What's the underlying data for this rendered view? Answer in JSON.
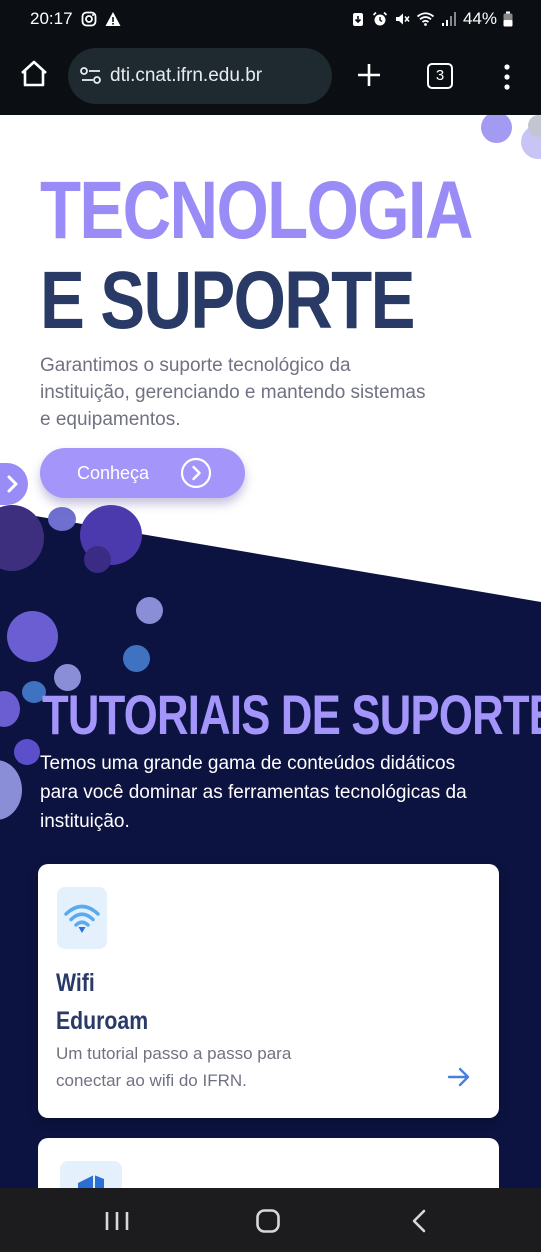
{
  "status_bar": {
    "time": "20:17",
    "battery": "44%",
    "left_icons": [
      "instagram-icon",
      "warning-icon"
    ],
    "right_icons": [
      "download-icon",
      "alarm-icon",
      "mute-icon",
      "wifi-icon",
      "signal-icon",
      "battery-icon"
    ]
  },
  "browser": {
    "url": "dti.cnat.ifrn.edu.br",
    "tab_count": "3"
  },
  "hero": {
    "title_line1": "TECNOLOGIA",
    "title_line2": "E SUPORTE",
    "description": "Garantimos o suporte tecnológico da instituição, gerenciando e mantendo sistemas e equipamentos.",
    "cta_label": "Conheça"
  },
  "tutorials": {
    "title": "TUTORIAIS DE SUPORTE",
    "description": "Temos uma grande gama de conteúdos didáticos para você dominar as ferramentas tecnológicas  da instituição.",
    "cards": [
      {
        "icon": "wifi-icon",
        "title_line1": "Wifi",
        "title_line2": "Eduroam",
        "description": "Um tutorial passo a passo para conectar ao wifi do IFRN."
      }
    ]
  },
  "colors": {
    "accent_purple": "#9a8cf7",
    "navy": "#2a3a66",
    "dark_section": "#0c1340",
    "text_gray": "#707282"
  }
}
